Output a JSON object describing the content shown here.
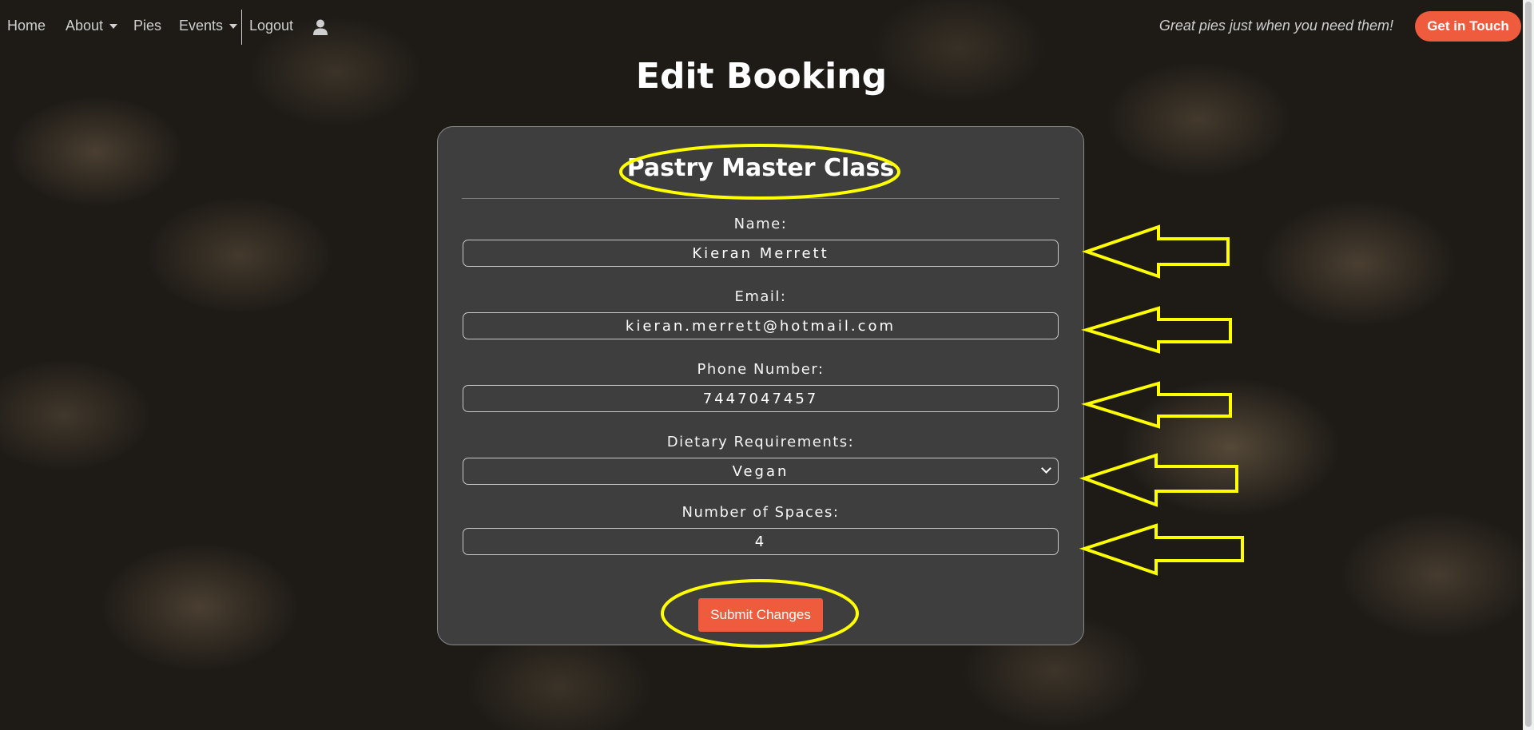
{
  "nav": {
    "home": "Home",
    "about": "About",
    "pies": "Pies",
    "events": "Events",
    "logout": "Logout",
    "tagline": "Great pies just when you need them!",
    "cta": "Get in Touch"
  },
  "page": {
    "title": "Edit Booking"
  },
  "form": {
    "event_title": "Pastry Master Class",
    "name_label": "Name:",
    "name_value": "Kieran Merrett",
    "email_label": "Email:",
    "email_value": "kieran.merrett@hotmail.com",
    "phone_label": "Phone Number:",
    "phone_value": "7447047457",
    "diet_label": "Dietary Requirements:",
    "diet_value": "Vegan",
    "spaces_label": "Number of Spaces:",
    "spaces_value": "4",
    "submit": "Submit Changes"
  },
  "colors": {
    "accent": "#ef5b3d",
    "card": "#3e3e3e",
    "annotation": "#ffff00"
  },
  "icons": {
    "user": "user-icon",
    "dropdown": "caret-down-icon",
    "select": "chevron-down-icon"
  }
}
